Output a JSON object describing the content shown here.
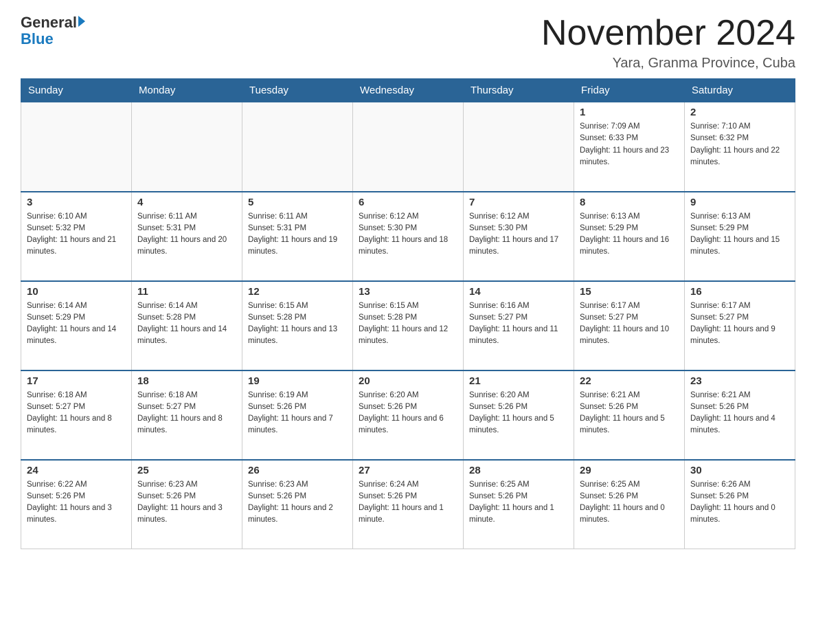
{
  "header": {
    "logo": {
      "general": "General",
      "blue": "Blue"
    },
    "title": "November 2024",
    "location": "Yara, Granma Province, Cuba"
  },
  "days_of_week": [
    "Sunday",
    "Monday",
    "Tuesday",
    "Wednesday",
    "Thursday",
    "Friday",
    "Saturday"
  ],
  "weeks": [
    [
      {
        "day": "",
        "info": ""
      },
      {
        "day": "",
        "info": ""
      },
      {
        "day": "",
        "info": ""
      },
      {
        "day": "",
        "info": ""
      },
      {
        "day": "",
        "info": ""
      },
      {
        "day": "1",
        "info": "Sunrise: 7:09 AM\nSunset: 6:33 PM\nDaylight: 11 hours and 23 minutes."
      },
      {
        "day": "2",
        "info": "Sunrise: 7:10 AM\nSunset: 6:32 PM\nDaylight: 11 hours and 22 minutes."
      }
    ],
    [
      {
        "day": "3",
        "info": "Sunrise: 6:10 AM\nSunset: 5:32 PM\nDaylight: 11 hours and 21 minutes."
      },
      {
        "day": "4",
        "info": "Sunrise: 6:11 AM\nSunset: 5:31 PM\nDaylight: 11 hours and 20 minutes."
      },
      {
        "day": "5",
        "info": "Sunrise: 6:11 AM\nSunset: 5:31 PM\nDaylight: 11 hours and 19 minutes."
      },
      {
        "day": "6",
        "info": "Sunrise: 6:12 AM\nSunset: 5:30 PM\nDaylight: 11 hours and 18 minutes."
      },
      {
        "day": "7",
        "info": "Sunrise: 6:12 AM\nSunset: 5:30 PM\nDaylight: 11 hours and 17 minutes."
      },
      {
        "day": "8",
        "info": "Sunrise: 6:13 AM\nSunset: 5:29 PM\nDaylight: 11 hours and 16 minutes."
      },
      {
        "day": "9",
        "info": "Sunrise: 6:13 AM\nSunset: 5:29 PM\nDaylight: 11 hours and 15 minutes."
      }
    ],
    [
      {
        "day": "10",
        "info": "Sunrise: 6:14 AM\nSunset: 5:29 PM\nDaylight: 11 hours and 14 minutes."
      },
      {
        "day": "11",
        "info": "Sunrise: 6:14 AM\nSunset: 5:28 PM\nDaylight: 11 hours and 14 minutes."
      },
      {
        "day": "12",
        "info": "Sunrise: 6:15 AM\nSunset: 5:28 PM\nDaylight: 11 hours and 13 minutes."
      },
      {
        "day": "13",
        "info": "Sunrise: 6:15 AM\nSunset: 5:28 PM\nDaylight: 11 hours and 12 minutes."
      },
      {
        "day": "14",
        "info": "Sunrise: 6:16 AM\nSunset: 5:27 PM\nDaylight: 11 hours and 11 minutes."
      },
      {
        "day": "15",
        "info": "Sunrise: 6:17 AM\nSunset: 5:27 PM\nDaylight: 11 hours and 10 minutes."
      },
      {
        "day": "16",
        "info": "Sunrise: 6:17 AM\nSunset: 5:27 PM\nDaylight: 11 hours and 9 minutes."
      }
    ],
    [
      {
        "day": "17",
        "info": "Sunrise: 6:18 AM\nSunset: 5:27 PM\nDaylight: 11 hours and 8 minutes."
      },
      {
        "day": "18",
        "info": "Sunrise: 6:18 AM\nSunset: 5:27 PM\nDaylight: 11 hours and 8 minutes."
      },
      {
        "day": "19",
        "info": "Sunrise: 6:19 AM\nSunset: 5:26 PM\nDaylight: 11 hours and 7 minutes."
      },
      {
        "day": "20",
        "info": "Sunrise: 6:20 AM\nSunset: 5:26 PM\nDaylight: 11 hours and 6 minutes."
      },
      {
        "day": "21",
        "info": "Sunrise: 6:20 AM\nSunset: 5:26 PM\nDaylight: 11 hours and 5 minutes."
      },
      {
        "day": "22",
        "info": "Sunrise: 6:21 AM\nSunset: 5:26 PM\nDaylight: 11 hours and 5 minutes."
      },
      {
        "day": "23",
        "info": "Sunrise: 6:21 AM\nSunset: 5:26 PM\nDaylight: 11 hours and 4 minutes."
      }
    ],
    [
      {
        "day": "24",
        "info": "Sunrise: 6:22 AM\nSunset: 5:26 PM\nDaylight: 11 hours and 3 minutes."
      },
      {
        "day": "25",
        "info": "Sunrise: 6:23 AM\nSunset: 5:26 PM\nDaylight: 11 hours and 3 minutes."
      },
      {
        "day": "26",
        "info": "Sunrise: 6:23 AM\nSunset: 5:26 PM\nDaylight: 11 hours and 2 minutes."
      },
      {
        "day": "27",
        "info": "Sunrise: 6:24 AM\nSunset: 5:26 PM\nDaylight: 11 hours and 1 minute."
      },
      {
        "day": "28",
        "info": "Sunrise: 6:25 AM\nSunset: 5:26 PM\nDaylight: 11 hours and 1 minute."
      },
      {
        "day": "29",
        "info": "Sunrise: 6:25 AM\nSunset: 5:26 PM\nDaylight: 11 hours and 0 minutes."
      },
      {
        "day": "30",
        "info": "Sunrise: 6:26 AM\nSunset: 5:26 PM\nDaylight: 11 hours and 0 minutes."
      }
    ]
  ]
}
